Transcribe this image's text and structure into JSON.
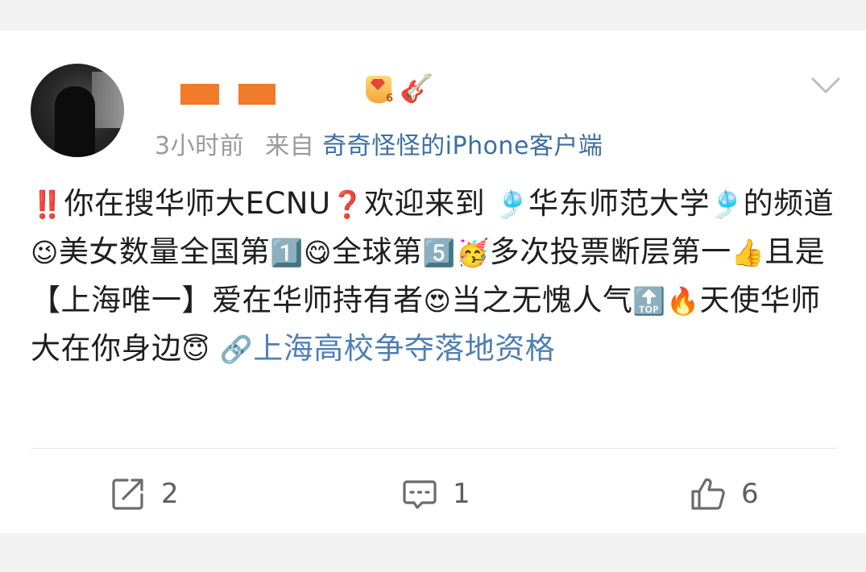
{
  "post": {
    "author_avatar_icon": "user-avatar",
    "badges": [
      "level-6-gem-badge-icon",
      "guitar-badge-icon"
    ],
    "meta": {
      "time": "3小时前",
      "source_prefix": "来自",
      "source": "奇奇怪怪的iPhone客户端"
    },
    "content": {
      "t1": "你在搜华师大ECNU",
      "t2": "欢迎来到",
      "t3": "华东师范大学",
      "t4": "的频道",
      "t5": "美女数量全国第",
      "t6": "全球第",
      "t7": "多次投票断层第一",
      "t8": "且是【上海唯一】爱在华师持有者",
      "t9": "当之无愧人气",
      "t10": "天使华师大在你身边",
      "link": "上海高校争夺落地资格"
    },
    "emojis": {
      "double_exclamation": "‼️",
      "red_question": "❓",
      "balloon": "🎐",
      "wink": "😉",
      "keycap_1": "1️⃣",
      "yum": "😋",
      "keycap_5": "5️⃣",
      "party": "🥳",
      "thumbs_up": "👍",
      "heart_eyes": "😍",
      "top": "🔝",
      "fire": "🔥",
      "halo": "😇",
      "link_icon": "🔗"
    },
    "actions": {
      "share_count": "2",
      "comment_count": "1",
      "like_count": "6"
    },
    "colors": {
      "accent_link": "#4f7fb3",
      "source_link": "#3d6e9e",
      "name_redaction": "#f07b2a",
      "meta_gray": "#9a9a9a"
    }
  }
}
